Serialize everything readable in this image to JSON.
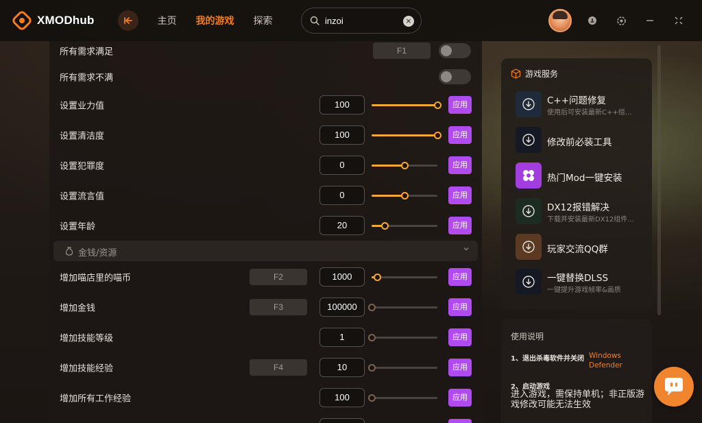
{
  "app": {
    "logo_text": "XMODhub"
  },
  "nav": {
    "items": [
      {
        "label": "主页",
        "active": false
      },
      {
        "label": "我的游戏",
        "active": true
      },
      {
        "label": "探索",
        "active": false
      }
    ]
  },
  "search": {
    "value": "inzoi",
    "clear_symbol": "×"
  },
  "main": {
    "rows_top": [
      {
        "label": "所有需求满足",
        "hotkey": "F1",
        "control": "toggle",
        "on": false
      },
      {
        "label": "所有需求不满",
        "control": "toggle",
        "on": false
      },
      {
        "label": "设置业力值",
        "value": "100",
        "level": 1.0,
        "apply": "应用"
      },
      {
        "label": "设置清洁度",
        "value": "100",
        "level": 1.0,
        "apply": "应用"
      },
      {
        "label": "设置犯罪度",
        "value": "0",
        "level": 0.5,
        "apply": "应用"
      },
      {
        "label": "设置流言值",
        "value": "0",
        "level": 0.5,
        "apply": "应用"
      },
      {
        "label": "设置年龄",
        "value": "20",
        "level": 0.2,
        "apply": "应用"
      }
    ],
    "section": {
      "title": "金钱/资源",
      "icon": "money-bag-icon",
      "collapsed_icon": "chevron-down-icon"
    },
    "rows_bottom": [
      {
        "label": "增加喵店里的喵币",
        "hotkey": "F2",
        "value": "1000",
        "level": 0.08,
        "apply": "应用"
      },
      {
        "label": "增加金钱",
        "hotkey": "F3",
        "value": "100000",
        "level": 0.0,
        "apply": "应用"
      },
      {
        "label": "增加技能等级",
        "value": "1",
        "level": 0.0,
        "apply": "应用"
      },
      {
        "label": "增加技能经验",
        "hotkey": "F4",
        "value": "10",
        "level": 0.0,
        "apply": "应用"
      },
      {
        "label": "增加所有工作经验",
        "value": "100",
        "level": 0.0,
        "apply": "应用"
      }
    ]
  },
  "services": {
    "title": "游戏服务",
    "items": [
      {
        "name": "C++问题修复",
        "sub": "使用后可安装最新C++组...",
        "icon": "download-icon",
        "color": "#1f2a3a"
      },
      {
        "name": "修改前必装工具",
        "sub": "",
        "icon": "download-icon",
        "color": "#151923"
      },
      {
        "name": "热门Mod一键安装",
        "sub": "",
        "icon": "mod-icon",
        "color": "#a23ee0"
      },
      {
        "name": "DX12报错解决",
        "sub": "下载并安装最新DX12组件...",
        "icon": "download-icon",
        "color": "#1d2c22"
      },
      {
        "name": "玩家交流QQ群",
        "sub": "",
        "icon": "download-icon",
        "color": "#5a3a22"
      },
      {
        "name": "一键替换DLSS",
        "sub": "一键提升游戏帧率&画质",
        "icon": "download-icon",
        "color": "#151923"
      }
    ]
  },
  "help": {
    "title": "使用说明",
    "step1_title": "1、退出杀毒软件并关闭",
    "step1_highlight": "Windows Defender",
    "step2_title": "2、启动游戏",
    "step2_body": "进入游戏，需保持单机；非正版游戏修改可能无法生效"
  },
  "colors": {
    "accent": "#f57c1f",
    "apply_button": "#b04cef",
    "slider": "#f5a73a"
  }
}
